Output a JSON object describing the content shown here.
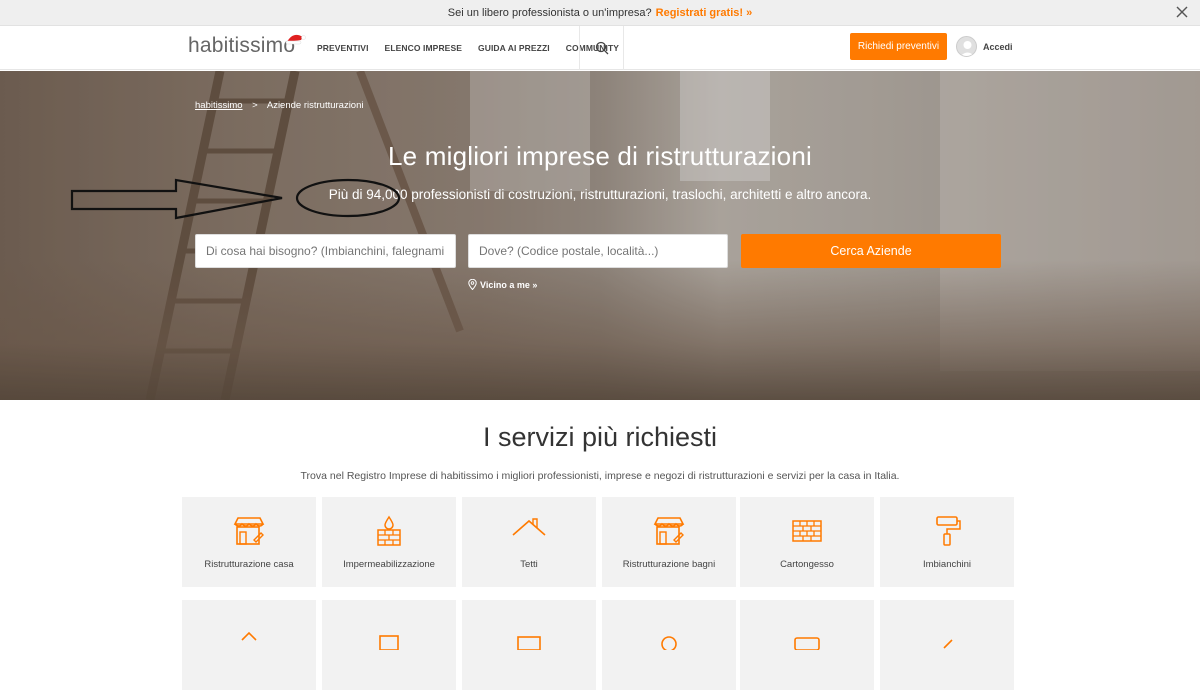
{
  "promo": {
    "text": "Sei un libero professionista o un'impresa?",
    "cta": "Registrati gratis! »"
  },
  "header": {
    "logo": "habitissimo",
    "nav": [
      "PREVENTIVI",
      "ELENCO IMPRESE",
      "GUIDA AI PREZZI",
      "COMMUNITY"
    ],
    "quote_button": "Richiedi preventivi",
    "login": "Accedi"
  },
  "hero": {
    "breadcrumb_home": "habitissimo",
    "breadcrumb_sep": ">",
    "breadcrumb_current": "Aziende ristrutturazioni",
    "title": "Le migliori imprese di ristrutturazioni",
    "subtitle": "Più di 94,000 professionisti di costruzioni, ristrutturazioni, traslochi, architetti e altro ancora.",
    "what_placeholder": "Di cosa hai bisogno? (Imbianchini, falegnami",
    "where_placeholder": "Dove? (Codice postale, località...)",
    "search_button": "Cerca Aziende",
    "near_me": "Vicino a me »"
  },
  "services": {
    "title": "I servizi più richiesti",
    "description": "Trova nel Registro Imprese di habitissimo i migliori professionisti, imprese e negozi di ristrutturazioni e servizi per la casa in Italia.",
    "items": [
      {
        "label": "Ristrutturazione casa",
        "icon": "shop-icon"
      },
      {
        "label": "Impermeabilizzazione",
        "icon": "drop-bricks-icon"
      },
      {
        "label": "Tetti",
        "icon": "roof-icon"
      },
      {
        "label": "Ristrutturazione bagni",
        "icon": "shop-icon"
      },
      {
        "label": "Cartongesso",
        "icon": "bricks-icon"
      },
      {
        "label": "Imbianchini",
        "icon": "paint-roller-icon"
      }
    ]
  },
  "colors": {
    "accent": "#ff7a00",
    "card_bg": "#f2f2f2"
  }
}
